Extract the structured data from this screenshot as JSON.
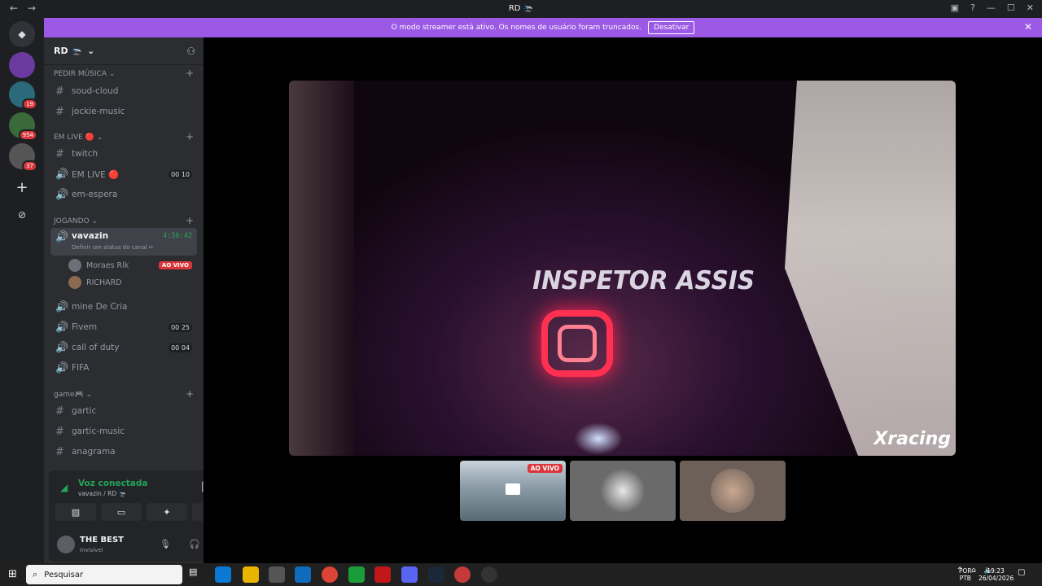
{
  "window": {
    "title": "RD 🛬",
    "nav_back": "←",
    "nav_fwd": "→"
  },
  "banner": {
    "text": "O modo streamer está ativo. Os nomes de usuário foram truncados.",
    "button": "Desativar",
    "close": "✕"
  },
  "rail": {
    "badges": [
      "19",
      "954",
      "37"
    ],
    "add": "+",
    "explore": "⊘"
  },
  "server": {
    "name": "RD 🛬",
    "chevron": "⌄"
  },
  "categories": [
    {
      "label": "PEDIR MÚSICA ⌄"
    },
    {
      "label": "EM LIVE 🔴 ⌄"
    },
    {
      "label": "JOGANDO ⌄"
    },
    {
      "label": "game🎮 ⌄"
    }
  ],
  "channels": {
    "soud_cloud": "soud-cloud",
    "jockie_music": "jockie-music",
    "twitch": "twitch",
    "em_live": "EM LIVE 🔴",
    "em_live_count_a": "00",
    "em_live_count_b": "10",
    "em_espera": "em-espera",
    "vavazin": "vavazin",
    "vavazin_time": "4:56:42",
    "vavazin_status": "Definir um status do canal ✏",
    "member1": "Moraes Rlk",
    "member1_live": "AO VIVO",
    "member2": "RICHARD",
    "mine": "mine De Cria",
    "fivem": "Fivem",
    "fivem_a": "00",
    "fivem_b": "25",
    "cod": "call of duty",
    "cod_a": "00",
    "cod_b": "04",
    "fifa": "FIFA",
    "gartic": "gartic",
    "gartic_music": "gartic-music",
    "anagrama": "anagrama"
  },
  "voice": {
    "status": "Voz conectada",
    "sub": "vavazin / RD 🛬"
  },
  "user": {
    "name": "THE BEST",
    "status": "Invisível"
  },
  "video": {
    "caption": "INSPETOR ASSIS",
    "logo": "Xracing"
  },
  "thumbs": {
    "live": "AO VIVO"
  },
  "taskbar": {
    "search": "Pesquisar",
    "lang1": "POR",
    "lang2": "PTB",
    "time": "19:23",
    "date": "26/04/2026"
  },
  "colors": {
    "accent": "#9b59e6",
    "live": "#da373c",
    "connected": "#23a55a"
  }
}
